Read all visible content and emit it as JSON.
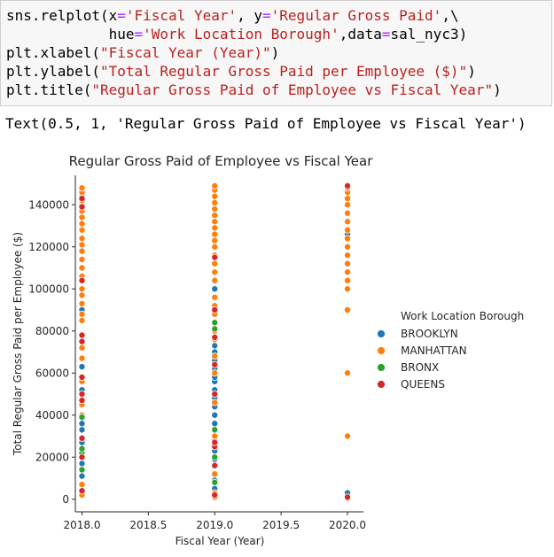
{
  "code": {
    "lines": [
      [
        {
          "t": "sns.relplot(x"
        },
        {
          "t": "=",
          "c": "kw"
        },
        {
          "t": "'Fiscal Year'",
          "c": "str"
        },
        {
          "t": ", y"
        },
        {
          "t": "=",
          "c": "kw"
        },
        {
          "t": "'Regular Gross Paid'",
          "c": "str"
        },
        {
          "t": ",\\"
        }
      ],
      [
        {
          "t": "            hue"
        },
        {
          "t": "=",
          "c": "kw"
        },
        {
          "t": "'Work Location Borough'",
          "c": "str"
        },
        {
          "t": ",data"
        },
        {
          "t": "=",
          "c": "kw"
        },
        {
          "t": "sal_nyc3)"
        }
      ],
      [
        {
          "t": "plt.xlabel("
        },
        {
          "t": "\"Fiscal Year (Year)\"",
          "c": "str"
        },
        {
          "t": ")"
        }
      ],
      [
        {
          "t": "plt.ylabel("
        },
        {
          "t": "\"Total Regular Gross Paid per Employee ($)\"",
          "c": "str"
        },
        {
          "t": ")"
        }
      ],
      [
        {
          "t": "plt.title("
        },
        {
          "t": "\"Regular Gross Paid of Employee vs Fiscal Year\"",
          "c": "str"
        },
        {
          "t": ")"
        }
      ]
    ]
  },
  "output_text": "Text(0.5, 1, 'Regular Gross Paid of Employee vs Fiscal Year')",
  "chart_data": {
    "type": "scatter",
    "title": "Regular Gross Paid of Employee vs Fiscal Year",
    "xlabel": "Fiscal Year (Year)",
    "ylabel": "Total Regular Gross Paid per Employee ($)",
    "xlim": [
      2017.95,
      2020.12
    ],
    "ylim": [
      -6000,
      154000
    ],
    "xticks": [
      2018.0,
      2018.5,
      2019.0,
      2019.5,
      2020.0
    ],
    "xtick_labels": [
      "2018.0",
      "2018.5",
      "2019.0",
      "2019.5",
      "2020.0"
    ],
    "yticks": [
      0,
      20000,
      40000,
      60000,
      80000,
      100000,
      120000,
      140000
    ],
    "ytick_labels": [
      "0",
      "20000",
      "40000",
      "60000",
      "80000",
      "100000",
      "120000",
      "140000"
    ],
    "grid": false,
    "legend": {
      "title": "Work Location Borough",
      "placement": "right"
    },
    "series": [
      {
        "name": "BROOKLYN",
        "color": "#1f77b4",
        "points": [
          [
            2018,
            11000
          ],
          [
            2018,
            17000
          ],
          [
            2018,
            27000
          ],
          [
            2018,
            33000
          ],
          [
            2018,
            36000
          ],
          [
            2018,
            52000
          ],
          [
            2018,
            63000
          ],
          [
            2018,
            90000
          ],
          [
            2019,
            5000
          ],
          [
            2019,
            9000
          ],
          [
            2019,
            19000
          ],
          [
            2019,
            23000
          ],
          [
            2019,
            28000
          ],
          [
            2019,
            36000
          ],
          [
            2019,
            40000
          ],
          [
            2019,
            44000
          ],
          [
            2019,
            48000
          ],
          [
            2019,
            52000
          ],
          [
            2019,
            56000
          ],
          [
            2019,
            58000
          ],
          [
            2019,
            62000
          ],
          [
            2019,
            66000
          ],
          [
            2019,
            70000
          ],
          [
            2019,
            73000
          ],
          [
            2019,
            100000
          ],
          [
            2020,
            3000
          ],
          [
            2020,
            126000
          ]
        ]
      },
      {
        "name": "MANHATTAN",
        "color": "#ff7f0e",
        "points": [
          [
            2018,
            2000
          ],
          [
            2018,
            7000
          ],
          [
            2018,
            40000
          ],
          [
            2018,
            45000
          ],
          [
            2018,
            56000
          ],
          [
            2018,
            67000
          ],
          [
            2018,
            72000
          ],
          [
            2018,
            85000
          ],
          [
            2018,
            88000
          ],
          [
            2018,
            93000
          ],
          [
            2018,
            97000
          ],
          [
            2018,
            100000
          ],
          [
            2018,
            106000
          ],
          [
            2018,
            110000
          ],
          [
            2018,
            114000
          ],
          [
            2018,
            118000
          ],
          [
            2018,
            121000
          ],
          [
            2018,
            124000
          ],
          [
            2018,
            128000
          ],
          [
            2018,
            131000
          ],
          [
            2018,
            134000
          ],
          [
            2018,
            137000
          ],
          [
            2018,
            140000
          ],
          [
            2018,
            142000
          ],
          [
            2018,
            144000
          ],
          [
            2018,
            146000
          ],
          [
            2018,
            148000
          ],
          [
            2019,
            1000
          ],
          [
            2019,
            3000
          ],
          [
            2019,
            12000
          ],
          [
            2019,
            30000
          ],
          [
            2019,
            46000
          ],
          [
            2019,
            60000
          ],
          [
            2019,
            68000
          ],
          [
            2019,
            76000
          ],
          [
            2019,
            80000
          ],
          [
            2019,
            88000
          ],
          [
            2019,
            92000
          ],
          [
            2019,
            96000
          ],
          [
            2019,
            104000
          ],
          [
            2019,
            108000
          ],
          [
            2019,
            112000
          ],
          [
            2019,
            116000
          ],
          [
            2019,
            120000
          ],
          [
            2019,
            123000
          ],
          [
            2019,
            126000
          ],
          [
            2019,
            129000
          ],
          [
            2019,
            132000
          ],
          [
            2019,
            135000
          ],
          [
            2019,
            138000
          ],
          [
            2019,
            141000
          ],
          [
            2019,
            144000
          ],
          [
            2019,
            147000
          ],
          [
            2019,
            149000
          ],
          [
            2020,
            500
          ],
          [
            2020,
            30000
          ],
          [
            2020,
            60000
          ],
          [
            2020,
            90000
          ],
          [
            2020,
            100000
          ],
          [
            2020,
            104000
          ],
          [
            2020,
            108000
          ],
          [
            2020,
            112000
          ],
          [
            2020,
            116000
          ],
          [
            2020,
            120000
          ],
          [
            2020,
            124000
          ],
          [
            2020,
            128000
          ],
          [
            2020,
            132000
          ],
          [
            2020,
            136000
          ],
          [
            2020,
            140000
          ],
          [
            2020,
            143000
          ],
          [
            2020,
            146000
          ],
          [
            2020,
            148000
          ]
        ]
      },
      {
        "name": "BRONX",
        "color": "#2ca02c",
        "points": [
          [
            2018,
            14000
          ],
          [
            2018,
            22000
          ],
          [
            2018,
            24000
          ],
          [
            2018,
            39000
          ],
          [
            2019,
            8000
          ],
          [
            2019,
            20000
          ],
          [
            2019,
            33000
          ],
          [
            2019,
            81000
          ],
          [
            2019,
            84000
          ]
        ]
      },
      {
        "name": "QUEENS",
        "color": "#d62728",
        "points": [
          [
            2018,
            4000
          ],
          [
            2018,
            20000
          ],
          [
            2018,
            29000
          ],
          [
            2018,
            47000
          ],
          [
            2018,
            50000
          ],
          [
            2018,
            58000
          ],
          [
            2018,
            75000
          ],
          [
            2018,
            78000
          ],
          [
            2018,
            104000
          ],
          [
            2018,
            139000
          ],
          [
            2018,
            143000
          ],
          [
            2019,
            2000
          ],
          [
            2019,
            16000
          ],
          [
            2019,
            25000
          ],
          [
            2019,
            27000
          ],
          [
            2019,
            50000
          ],
          [
            2019,
            64000
          ],
          [
            2019,
            77000
          ],
          [
            2019,
            90000
          ],
          [
            2019,
            115000
          ],
          [
            2020,
            1000
          ],
          [
            2020,
            149000
          ]
        ]
      }
    ]
  }
}
